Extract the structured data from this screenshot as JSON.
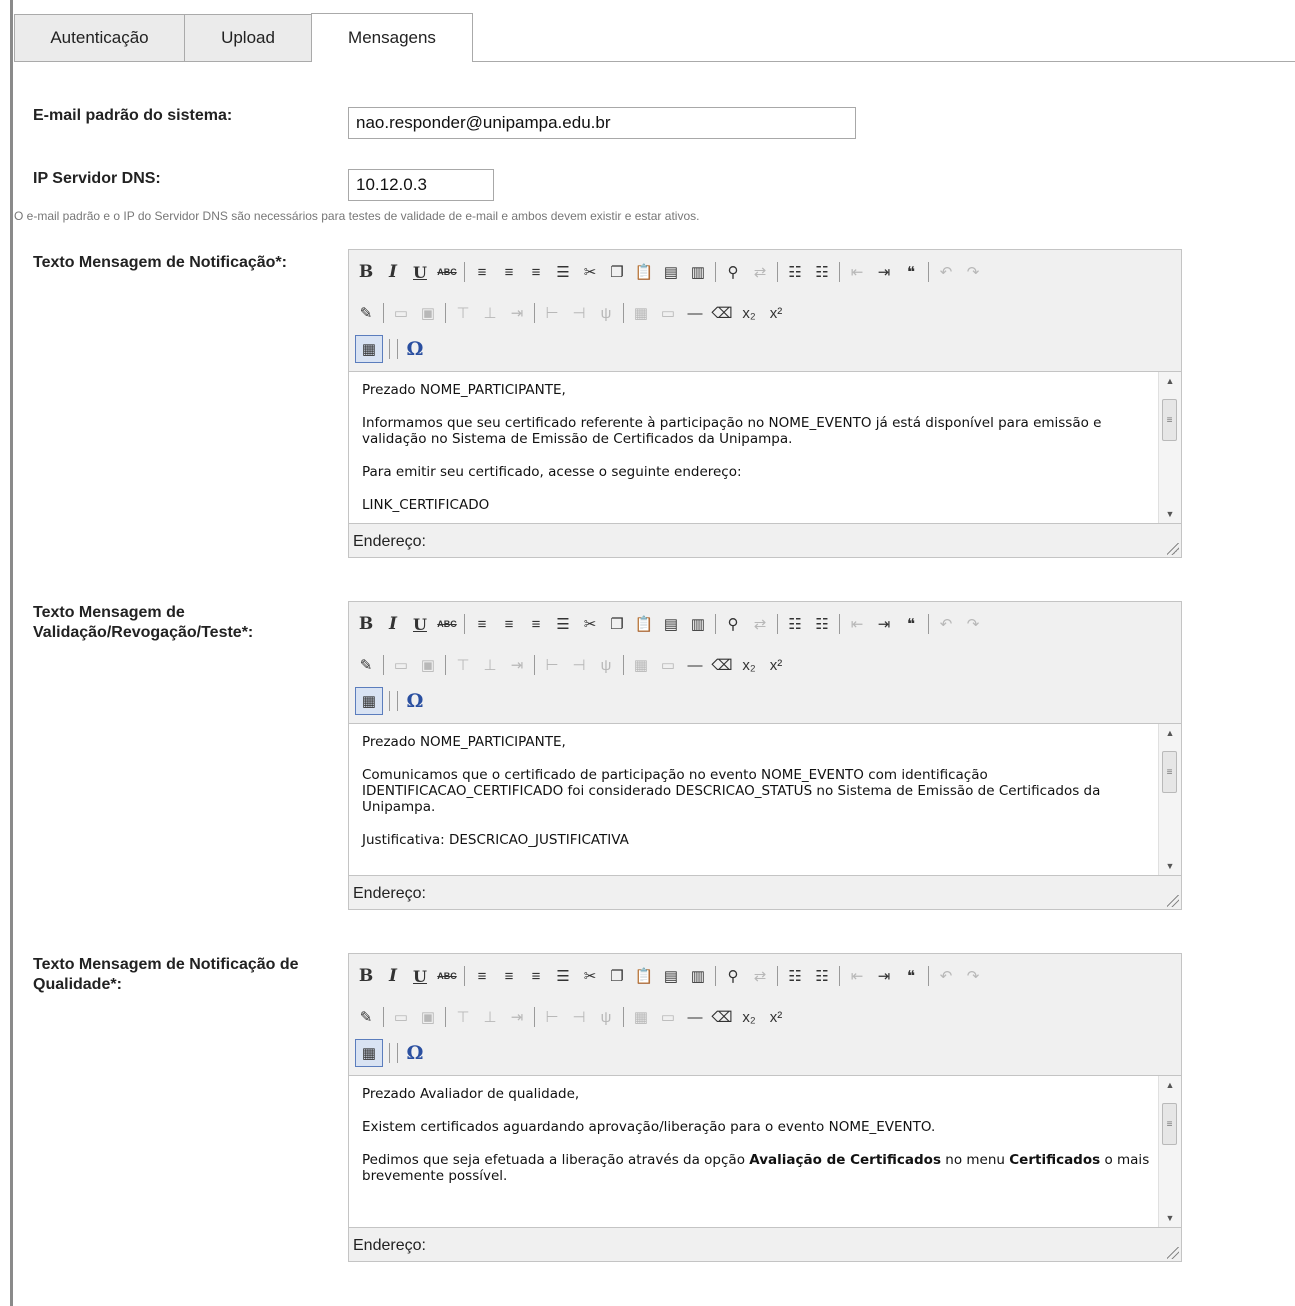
{
  "tabs": [
    {
      "label": "Autenticação",
      "active": false
    },
    {
      "label": "Upload",
      "active": false
    },
    {
      "label": "Mensagens",
      "active": true
    }
  ],
  "form": {
    "email_label": "E-mail padrão do sistema:",
    "email_value": "nao.responder@unipampa.edu.br",
    "dns_label": "IP Servidor DNS:",
    "dns_value": "10.12.0.3",
    "hint": "O e-mail padrão e o IP do Servidor DNS são necessários para testes de validade de e-mail e ambos devem existir e estar ativos."
  },
  "toolbar": {
    "bold": "B",
    "italic": "I",
    "underline": "U",
    "strike": "ABC",
    "special_char": "Ω"
  },
  "editors": [
    {
      "label_line1": "Texto Mensagem de Notificação*:",
      "label_line2": "",
      "status": "Endereço:",
      "paragraphs": [
        "Prezado NOME_PARTICIPANTE,",
        "Informamos que seu certificado referente à participação no NOME_EVENTO já está disponível para emissão e validação no Sistema de Emissão de Certificados da Unipampa.",
        "Para emitir seu certificado, acesse o seguinte endereço:",
        "LINK_CERTIFICADO"
      ]
    },
    {
      "label_line1": "Texto Mensagem de",
      "label_line2": "Validação/Revogação/Teste*:",
      "status": "Endereço:",
      "paragraphs": [
        "Prezado NOME_PARTICIPANTE,",
        "Comunicamos que o certificado de participação no evento NOME_EVENTO com identificação IDENTIFICACAO_CERTIFICADO foi considerado DESCRICAO_STATUS no Sistema de Emissão de Certificados da Unipampa.",
        "Justificativa: DESCRICAO_JUSTIFICATIVA"
      ]
    },
    {
      "label_line1": "Texto Mensagem de Notificação de",
      "label_line2": "Qualidade*:",
      "status": "Endereço:",
      "paragraphs": [
        "Prezado Avaliador de qualidade,",
        "Existem certificados aguardando aprovação/liberação para o evento NOME_EVENTO."
      ],
      "last_paragraph": {
        "t1": "Pedimos que seja efetuada a liberação através da opção ",
        "b1": "Avaliação de Certificados",
        "t2": " no menu ",
        "b2": "Certificados",
        "t3": " o mais brevemente possível."
      }
    }
  ]
}
